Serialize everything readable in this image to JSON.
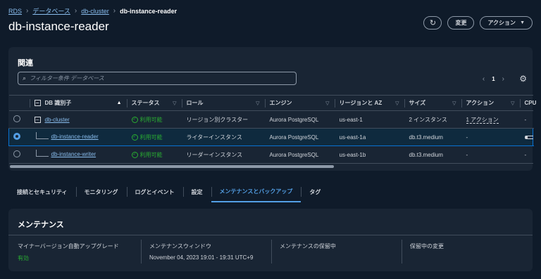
{
  "breadcrumb": {
    "items": [
      "RDS",
      "データベース",
      "db-cluster"
    ],
    "current": "db-instance-reader"
  },
  "page": {
    "title": "db-instance-reader"
  },
  "actions": {
    "refresh_icon": "↻",
    "modify": "変更",
    "actions": "アクション",
    "caret": "▼"
  },
  "related": {
    "title": "関連",
    "filter_placeholder": "フィルター条件 データベース",
    "search_icon": "⌕",
    "page_number": "1",
    "prev": "‹",
    "next": "›",
    "settings_icon": "⚙",
    "columns": [
      "DB 識別子",
      "ステータス",
      "ロール",
      "エンジン",
      "リージョンと AZ",
      "サイズ",
      "アクション",
      "CPU"
    ],
    "rows": [
      {
        "id": "db-cluster",
        "status": "利用可能",
        "role": "リージョン別クラスター",
        "engine": "Aurora PostgreSQL",
        "region": "us-east-1",
        "size": "2 インスタンス",
        "action": "1 アクション",
        "cpu": "-"
      },
      {
        "id": "db-instance-reader",
        "status": "利用可能",
        "role": "ライターインスタンス",
        "engine": "Aurora PostgreSQL",
        "region": "us-east-1a",
        "size": "db.t3.medium",
        "action": "-",
        "cpu_fraction": 0.15
      },
      {
        "id": "db-instance-writer",
        "status": "利用可能",
        "role": "リーダーインスタンス",
        "engine": "Aurora PostgreSQL",
        "region": "us-east-1b",
        "size": "db.t3.medium",
        "action": "-",
        "cpu": "-"
      }
    ]
  },
  "tabs": [
    "接続とセキュリティ",
    "モニタリング",
    "ログとイベント",
    "設定",
    "メンテナンスとバックアップ",
    "タグ"
  ],
  "maintenance": {
    "title": "メンテナンス",
    "auto_upgrade_label": "マイナーバージョン自動アップグレード",
    "auto_upgrade_value": "有効",
    "window_label": "メンテナンスウィンドウ",
    "window_value": "November 04, 2023 19:01 - 19:31 UTC+9",
    "pending_label": "メンテナンスの保留中",
    "pending_changes_label": "保留中の変更"
  },
  "colors": {
    "accent": "#539fe5",
    "success": "#29ad32",
    "background": "#0f1b2a",
    "panel": "#192534"
  }
}
